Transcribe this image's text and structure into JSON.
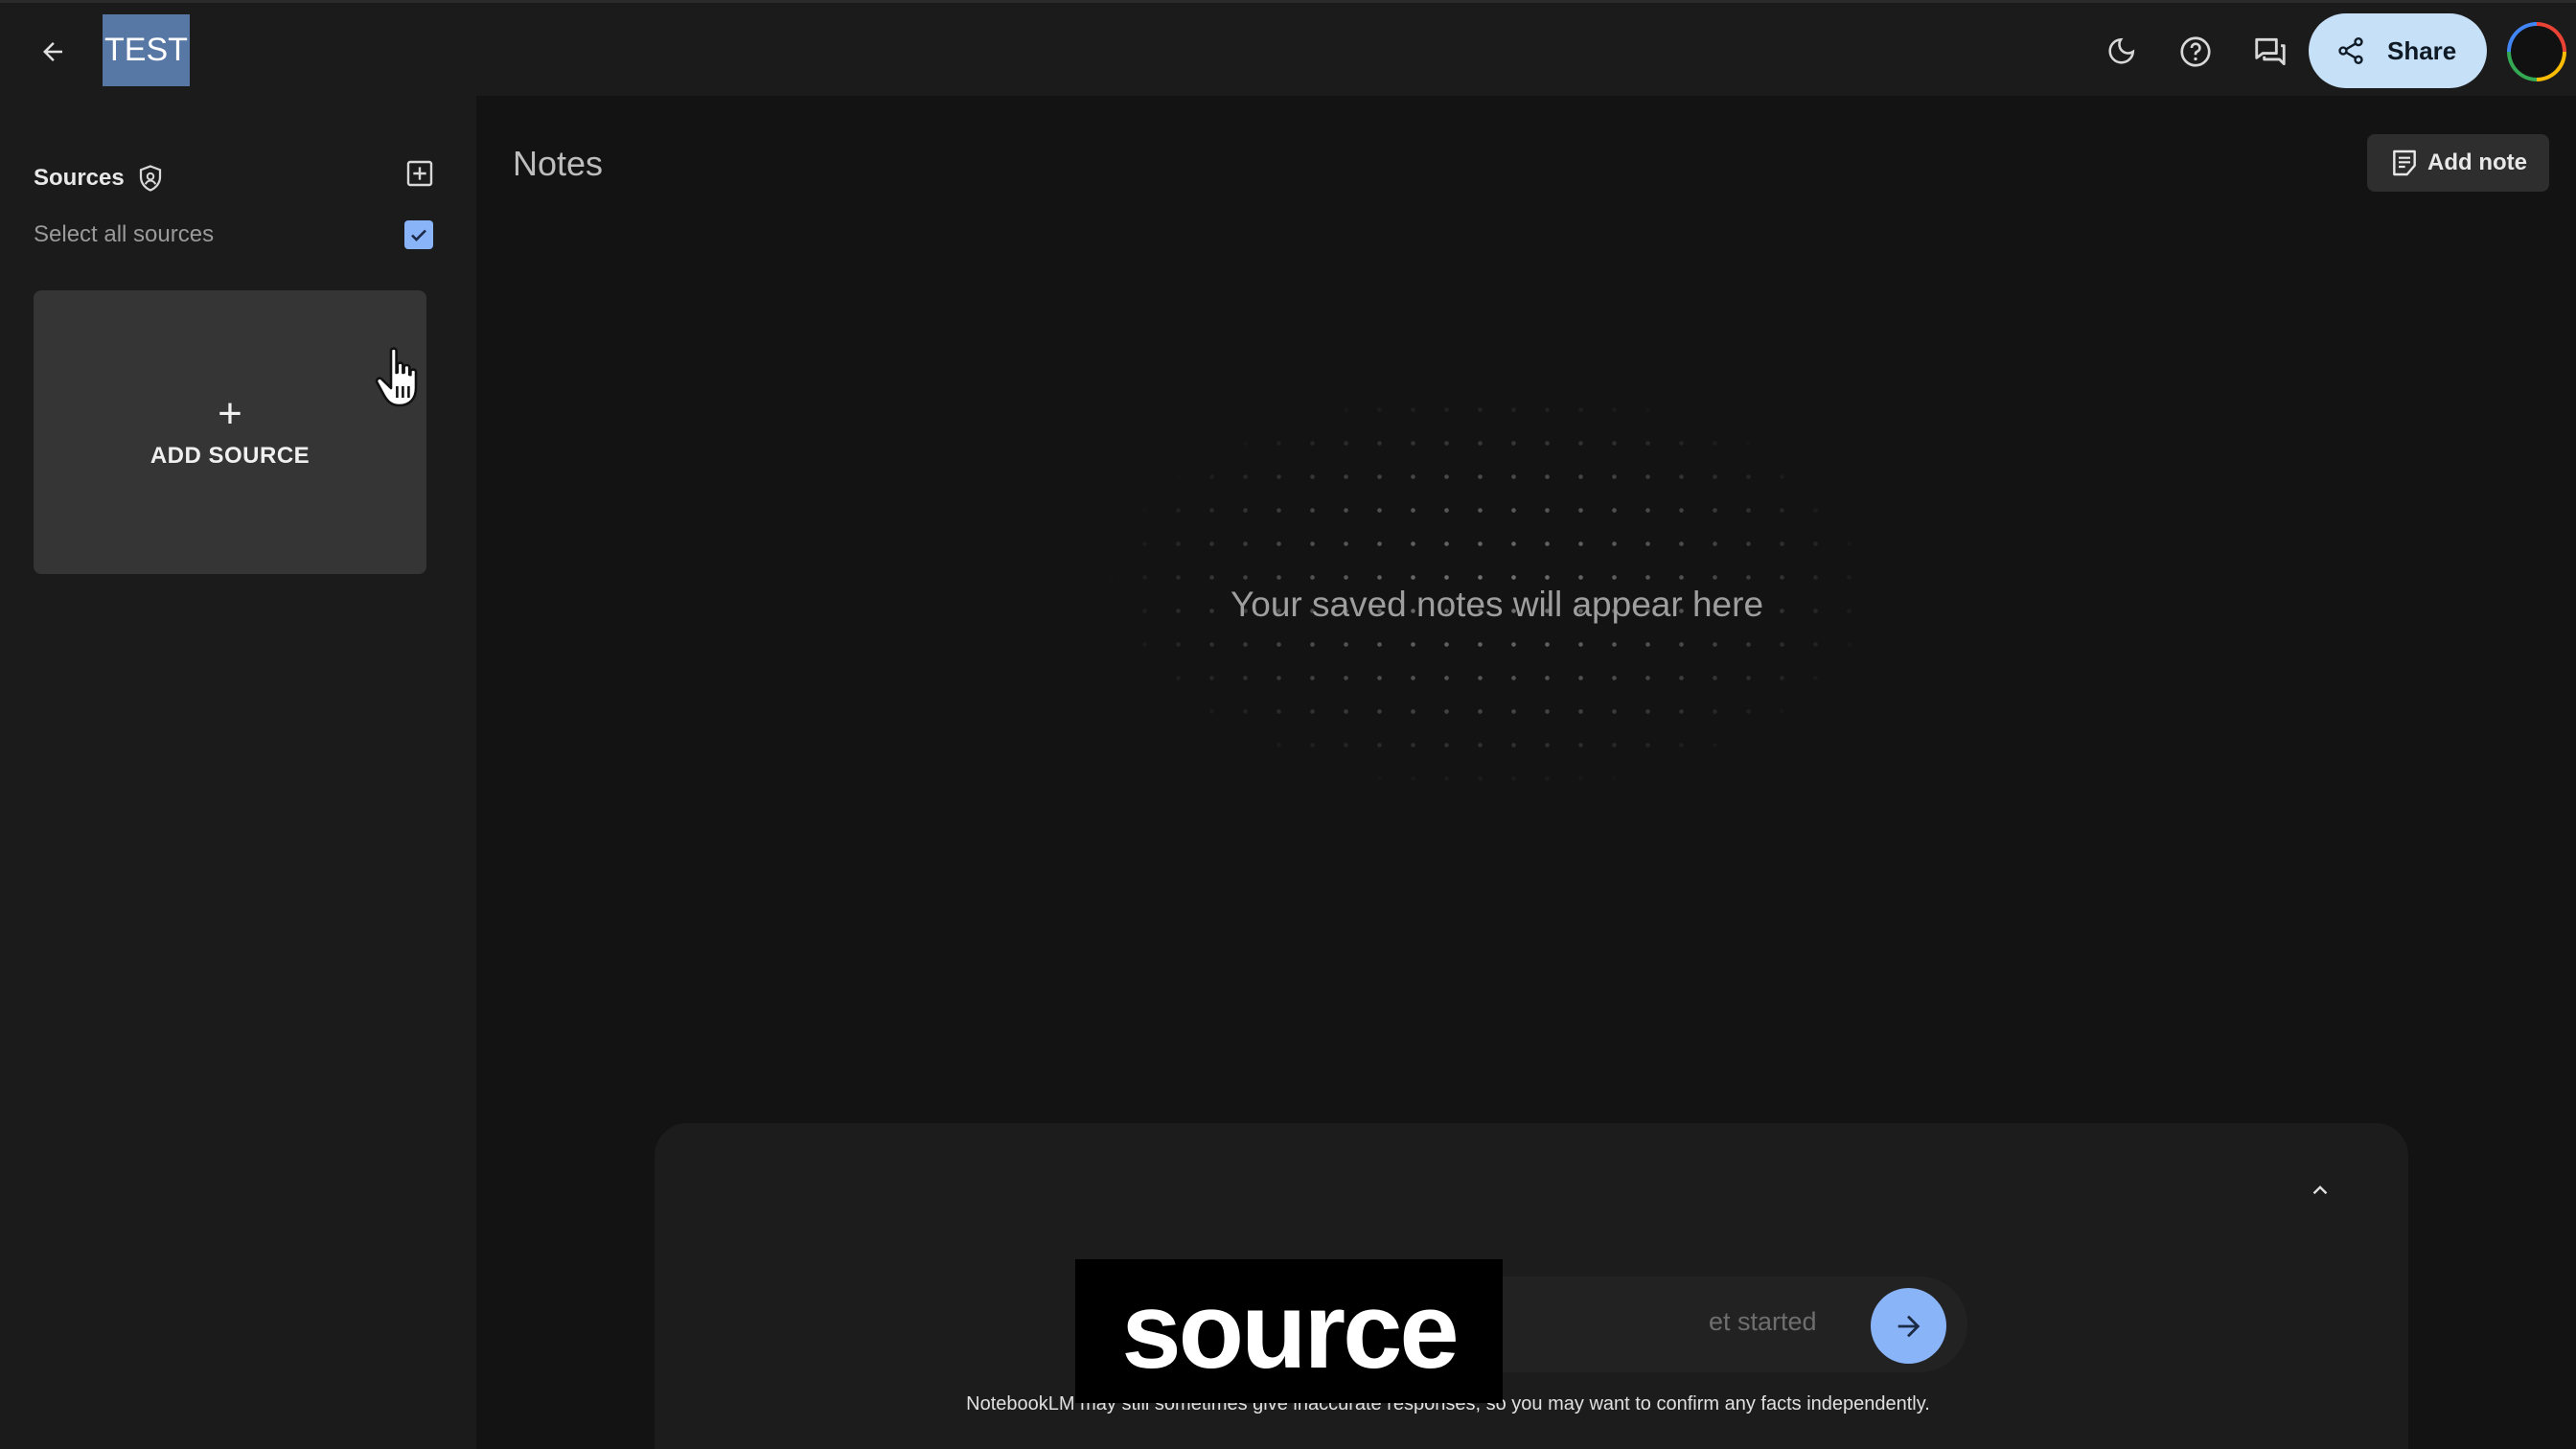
{
  "header": {
    "notebook_title": "TEST",
    "share_label": "Share",
    "icons": [
      "arrow-back-icon",
      "dark-mode-icon",
      "help-icon",
      "chat-icon",
      "share-icon",
      "avatar"
    ]
  },
  "sidebar": {
    "sources_title": "Sources",
    "select_all_label": "Select all sources",
    "select_all_checked": true,
    "add_source_label": "ADD SOURCE"
  },
  "notes": {
    "title": "Notes",
    "add_note_label": "Add note",
    "empty_message": "Your saved notes will appear here"
  },
  "chat": {
    "input_placeholder": "et started",
    "disclaimer": "NotebookLM may still sometimes give inaccurate responses, so you may want to confirm any facts independently."
  },
  "overlay": {
    "caption_text": "source"
  },
  "colors": {
    "background": "#131313",
    "panel": "#1b1b1b",
    "title_badge": "#5777a5",
    "share_button": "#c5e0f7",
    "accent_blue": "#8ab4f8",
    "card": "#353535"
  }
}
